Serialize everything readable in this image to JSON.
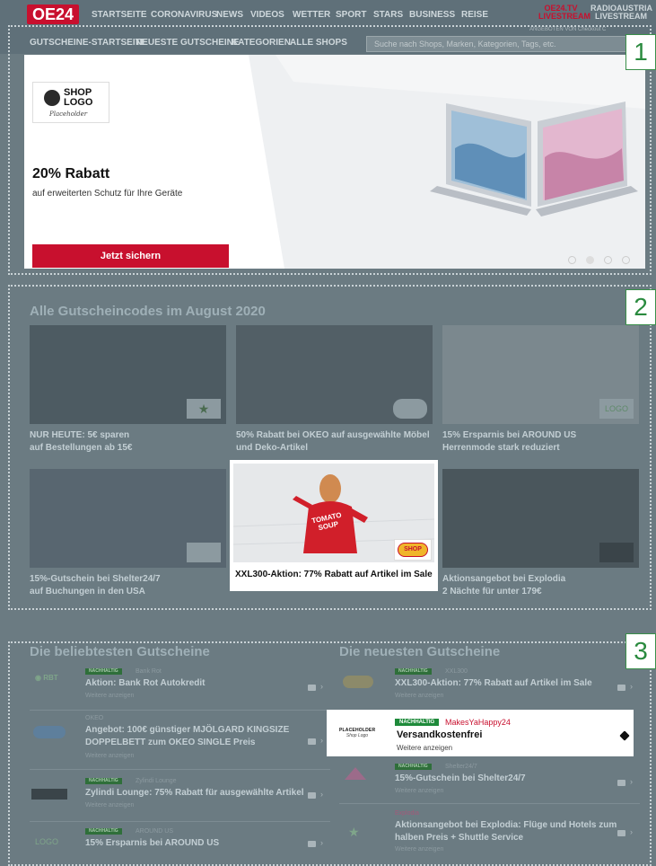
{
  "nav": {
    "logo": "OE24",
    "items": [
      "STARTSEITE",
      "CORONAVIRUS",
      "NEWS",
      "VIDEOS",
      "WETTER",
      "SPORT",
      "STARS",
      "BUSINESS",
      "REISE"
    ],
    "oe24tv": "OE24.TV",
    "livestream": "LIVESTREAM",
    "radio": "RADIOAUSTRIA",
    "radio_live": "LIVESTREAM",
    "checkout": "ANGEBOTEN VON Checkout C"
  },
  "subnav": {
    "items": [
      "GUTSCHEINE-STARTSEITE",
      "NEUESTE GUTSCHEINE",
      "KATEGORIEN",
      "ALLE SHOPS"
    ],
    "search_placeholder": "Suche nach Shops, Marken, Kategorien, Tags, etc."
  },
  "markers": {
    "one": "1",
    "two": "2",
    "three": "3"
  },
  "hero": {
    "logo_line1": "SHOP",
    "logo_line2": "LOGO",
    "logo_script": "Placeholder",
    "title": "20% Rabatt",
    "subtitle": "auf erweiterten Schutz für Ihre Geräte",
    "cta": "Jetzt sichern",
    "slide_count": 4,
    "active_slide": 2
  },
  "codes": {
    "heading": "Alle Gutscheincodes im August 2020",
    "tiles": [
      {
        "line1": "NUR HEUTE: 5€ sparen",
        "line2": "auf Bestellungen ab 15€"
      },
      {
        "line1": "50% Rabatt bei OKEO auf ausgewählte Möbel",
        "line2": "und Deko-Artikel"
      },
      {
        "line1": "15% Ersparnis bei AROUND US",
        "line2": "Herrenmode stark reduziert"
      },
      {
        "line1": "15%-Gutschein bei Shelter24/7",
        "line2": "auf Buchungen in den USA"
      },
      {
        "line1": "XXL300-Aktion: 77% Rabatt auf Artikel im Sale",
        "line2": ""
      },
      {
        "line1": "Aktionsangebot bei Explodia",
        "line2": "2 Nächte für unter 179€"
      }
    ],
    "shirt_text1": "TOMATO",
    "shirt_text2": "SOUP",
    "badge_shop": "SHOP",
    "badge_logo": "LOGO"
  },
  "popular": {
    "heading": "Die beliebtesten Gutscheine",
    "rows": [
      {
        "badge": "NACHHALTIG",
        "shop": "Bank Rot",
        "title": "Aktion: Bank Rot Autokredit",
        "title2": "",
        "more": "Weitere anzeigen"
      },
      {
        "badge": "",
        "shop": "OKEO",
        "title": "Angebot: 100€ günstiger MJÖLGARD KINGSIZE",
        "title2": "DOPPELBETT zum OKEO SINGLE Preis",
        "more": "Weitere anzeigen"
      },
      {
        "badge": "NACHHALTIG",
        "shop": "Zylindi Lounge",
        "title": "Zylindi Lounge: 75% Rabatt für ausgewählte Artikel",
        "title2": "",
        "more": "Weitere anzeigen"
      },
      {
        "badge": "NACHHALTIG",
        "shop": "AROUND US",
        "title": "15% Ersparnis bei AROUND US",
        "title2": "",
        "more": "Weitere anzeigen"
      }
    ]
  },
  "newest": {
    "heading": "Die neuesten Gutscheine",
    "rows": [
      {
        "badge": "NACHHALTIG",
        "shop": "XXL300",
        "title": "XXL300-Aktion: 77% Rabatt auf Artikel im Sale",
        "title2": "",
        "more": "Weitere anzeigen"
      },
      {
        "badge": "NACHHALTIG",
        "shop": "MakesYaHappy24",
        "title": "Versandkostenfrei",
        "title2": "",
        "more": "Weitere anzeigen"
      },
      {
        "badge": "NACHHALTIG",
        "shop": "Shelter24/7",
        "title": "15%-Gutschein bei Shelter24/7",
        "title2": "",
        "more": "Weitere anzeigen"
      },
      {
        "badge": "",
        "shop": "Explodia",
        "title": "Aktionsangebot bei Explodia: Flüge und Hotels zum",
        "title2": "halben Preis + Shuttle Service",
        "more": "Weitere anzeigen"
      }
    ],
    "card_logo1": "PLACEHOLDER",
    "card_logo2": "Shop Logo"
  },
  "colors": {
    "accent": "#c8102e",
    "badge_green": "#1e8a3a",
    "overlay": "#6b7b82"
  }
}
